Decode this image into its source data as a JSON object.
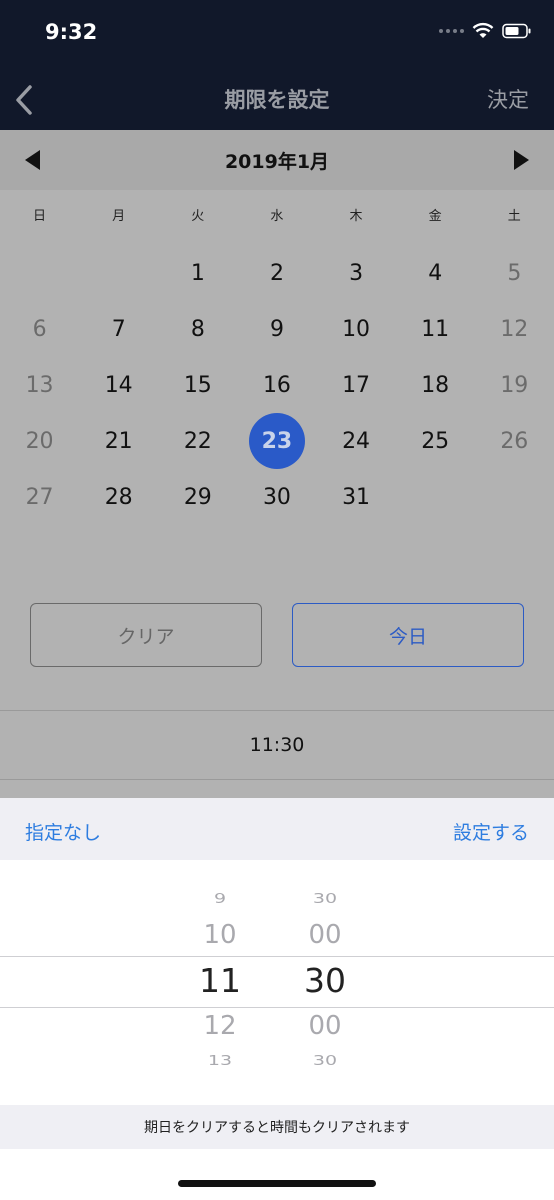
{
  "status_bar": {
    "time": "9:32"
  },
  "nav": {
    "title": "期限を設定",
    "action": "決定",
    "back_icon": "chevron-left-icon"
  },
  "calendar": {
    "month_label": "2019年1月",
    "weekdays": [
      "日",
      "月",
      "火",
      "水",
      "木",
      "金",
      "土"
    ],
    "weeks": [
      [
        "",
        "",
        "1",
        "2",
        "3",
        "4",
        "5"
      ],
      [
        "6",
        "7",
        "8",
        "9",
        "10",
        "11",
        "12"
      ],
      [
        "13",
        "14",
        "15",
        "16",
        "17",
        "18",
        "19"
      ],
      [
        "20",
        "21",
        "22",
        "23",
        "24",
        "25",
        "26"
      ],
      [
        "27",
        "28",
        "29",
        "30",
        "31",
        "",
        ""
      ]
    ],
    "selected_day": "23",
    "accent_color": "#2a5ac8"
  },
  "buttons": {
    "clear_label": "クリア",
    "today_label": "今日"
  },
  "time_display": "11:30",
  "picker_toolbar": {
    "left_label": "指定なし",
    "right_label": "設定する"
  },
  "picker": {
    "hours": [
      "9",
      "10",
      "11",
      "12",
      "13"
    ],
    "minutes": [
      "30",
      "00",
      "30",
      "00",
      "30"
    ],
    "selected_hour": "11",
    "selected_minute": "30"
  },
  "picker_note": "期日をクリアすると時間もクリアされます"
}
